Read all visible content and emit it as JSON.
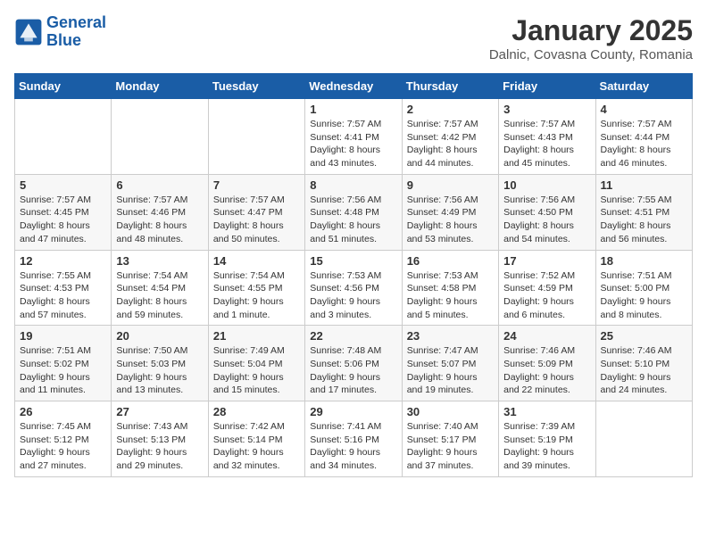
{
  "logo": {
    "line1": "General",
    "line2": "Blue"
  },
  "title": "January 2025",
  "location": "Dalnic, Covasna County, Romania",
  "weekdays": [
    "Sunday",
    "Monday",
    "Tuesday",
    "Wednesday",
    "Thursday",
    "Friday",
    "Saturday"
  ],
  "weeks": [
    [
      null,
      null,
      null,
      {
        "day": 1,
        "sunrise": "7:57 AM",
        "sunset": "4:41 PM",
        "daylight": "8 hours and 43 minutes."
      },
      {
        "day": 2,
        "sunrise": "7:57 AM",
        "sunset": "4:42 PM",
        "daylight": "8 hours and 44 minutes."
      },
      {
        "day": 3,
        "sunrise": "7:57 AM",
        "sunset": "4:43 PM",
        "daylight": "8 hours and 45 minutes."
      },
      {
        "day": 4,
        "sunrise": "7:57 AM",
        "sunset": "4:44 PM",
        "daylight": "8 hours and 46 minutes."
      }
    ],
    [
      {
        "day": 5,
        "sunrise": "7:57 AM",
        "sunset": "4:45 PM",
        "daylight": "8 hours and 47 minutes."
      },
      {
        "day": 6,
        "sunrise": "7:57 AM",
        "sunset": "4:46 PM",
        "daylight": "8 hours and 48 minutes."
      },
      {
        "day": 7,
        "sunrise": "7:57 AM",
        "sunset": "4:47 PM",
        "daylight": "8 hours and 50 minutes."
      },
      {
        "day": 8,
        "sunrise": "7:56 AM",
        "sunset": "4:48 PM",
        "daylight": "8 hours and 51 minutes."
      },
      {
        "day": 9,
        "sunrise": "7:56 AM",
        "sunset": "4:49 PM",
        "daylight": "8 hours and 53 minutes."
      },
      {
        "day": 10,
        "sunrise": "7:56 AM",
        "sunset": "4:50 PM",
        "daylight": "8 hours and 54 minutes."
      },
      {
        "day": 11,
        "sunrise": "7:55 AM",
        "sunset": "4:51 PM",
        "daylight": "8 hours and 56 minutes."
      }
    ],
    [
      {
        "day": 12,
        "sunrise": "7:55 AM",
        "sunset": "4:53 PM",
        "daylight": "8 hours and 57 minutes."
      },
      {
        "day": 13,
        "sunrise": "7:54 AM",
        "sunset": "4:54 PM",
        "daylight": "8 hours and 59 minutes."
      },
      {
        "day": 14,
        "sunrise": "7:54 AM",
        "sunset": "4:55 PM",
        "daylight": "9 hours and 1 minute."
      },
      {
        "day": 15,
        "sunrise": "7:53 AM",
        "sunset": "4:56 PM",
        "daylight": "9 hours and 3 minutes."
      },
      {
        "day": 16,
        "sunrise": "7:53 AM",
        "sunset": "4:58 PM",
        "daylight": "9 hours and 5 minutes."
      },
      {
        "day": 17,
        "sunrise": "7:52 AM",
        "sunset": "4:59 PM",
        "daylight": "9 hours and 6 minutes."
      },
      {
        "day": 18,
        "sunrise": "7:51 AM",
        "sunset": "5:00 PM",
        "daylight": "9 hours and 8 minutes."
      }
    ],
    [
      {
        "day": 19,
        "sunrise": "7:51 AM",
        "sunset": "5:02 PM",
        "daylight": "9 hours and 11 minutes."
      },
      {
        "day": 20,
        "sunrise": "7:50 AM",
        "sunset": "5:03 PM",
        "daylight": "9 hours and 13 minutes."
      },
      {
        "day": 21,
        "sunrise": "7:49 AM",
        "sunset": "5:04 PM",
        "daylight": "9 hours and 15 minutes."
      },
      {
        "day": 22,
        "sunrise": "7:48 AM",
        "sunset": "5:06 PM",
        "daylight": "9 hours and 17 minutes."
      },
      {
        "day": 23,
        "sunrise": "7:47 AM",
        "sunset": "5:07 PM",
        "daylight": "9 hours and 19 minutes."
      },
      {
        "day": 24,
        "sunrise": "7:46 AM",
        "sunset": "5:09 PM",
        "daylight": "9 hours and 22 minutes."
      },
      {
        "day": 25,
        "sunrise": "7:46 AM",
        "sunset": "5:10 PM",
        "daylight": "9 hours and 24 minutes."
      }
    ],
    [
      {
        "day": 26,
        "sunrise": "7:45 AM",
        "sunset": "5:12 PM",
        "daylight": "9 hours and 27 minutes."
      },
      {
        "day": 27,
        "sunrise": "7:43 AM",
        "sunset": "5:13 PM",
        "daylight": "9 hours and 29 minutes."
      },
      {
        "day": 28,
        "sunrise": "7:42 AM",
        "sunset": "5:14 PM",
        "daylight": "9 hours and 32 minutes."
      },
      {
        "day": 29,
        "sunrise": "7:41 AM",
        "sunset": "5:16 PM",
        "daylight": "9 hours and 34 minutes."
      },
      {
        "day": 30,
        "sunrise": "7:40 AM",
        "sunset": "5:17 PM",
        "daylight": "9 hours and 37 minutes."
      },
      {
        "day": 31,
        "sunrise": "7:39 AM",
        "sunset": "5:19 PM",
        "daylight": "9 hours and 39 minutes."
      },
      null
    ]
  ],
  "labels": {
    "sunrise": "Sunrise:",
    "sunset": "Sunset:",
    "daylight": "Daylight:"
  }
}
